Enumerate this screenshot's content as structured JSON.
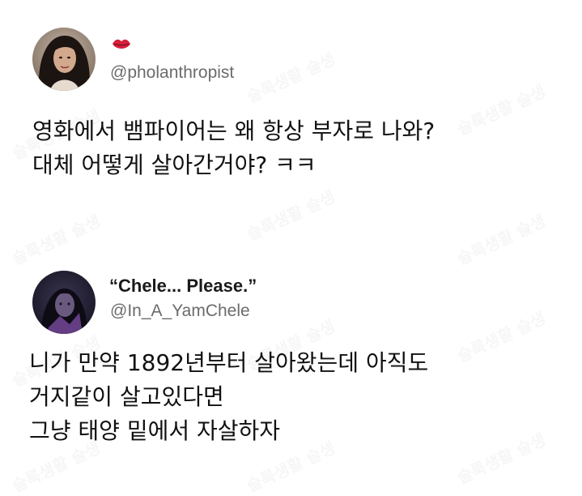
{
  "tweets": [
    {
      "display_name": "",
      "name_icon": "lips-icon",
      "handle": "@pholanthropist",
      "lines": [
        "영화에서 뱀파이어는 왜 항상 부자로 나와?",
        "대체 어떻게 살아간거야? ㅋㅋ"
      ]
    },
    {
      "display_name": "“Chele... Please.”",
      "handle": "@In_A_YamChele",
      "lines": [
        "니가 만약 1892년부터 살아왔는데 아직도",
        "거지같이 살고있다면",
        "그냥 태양 밑에서 자살하자"
      ]
    }
  ],
  "colors": {
    "lips": "#d61f3c",
    "handle": "#6b6b6b",
    "text": "#111111"
  }
}
